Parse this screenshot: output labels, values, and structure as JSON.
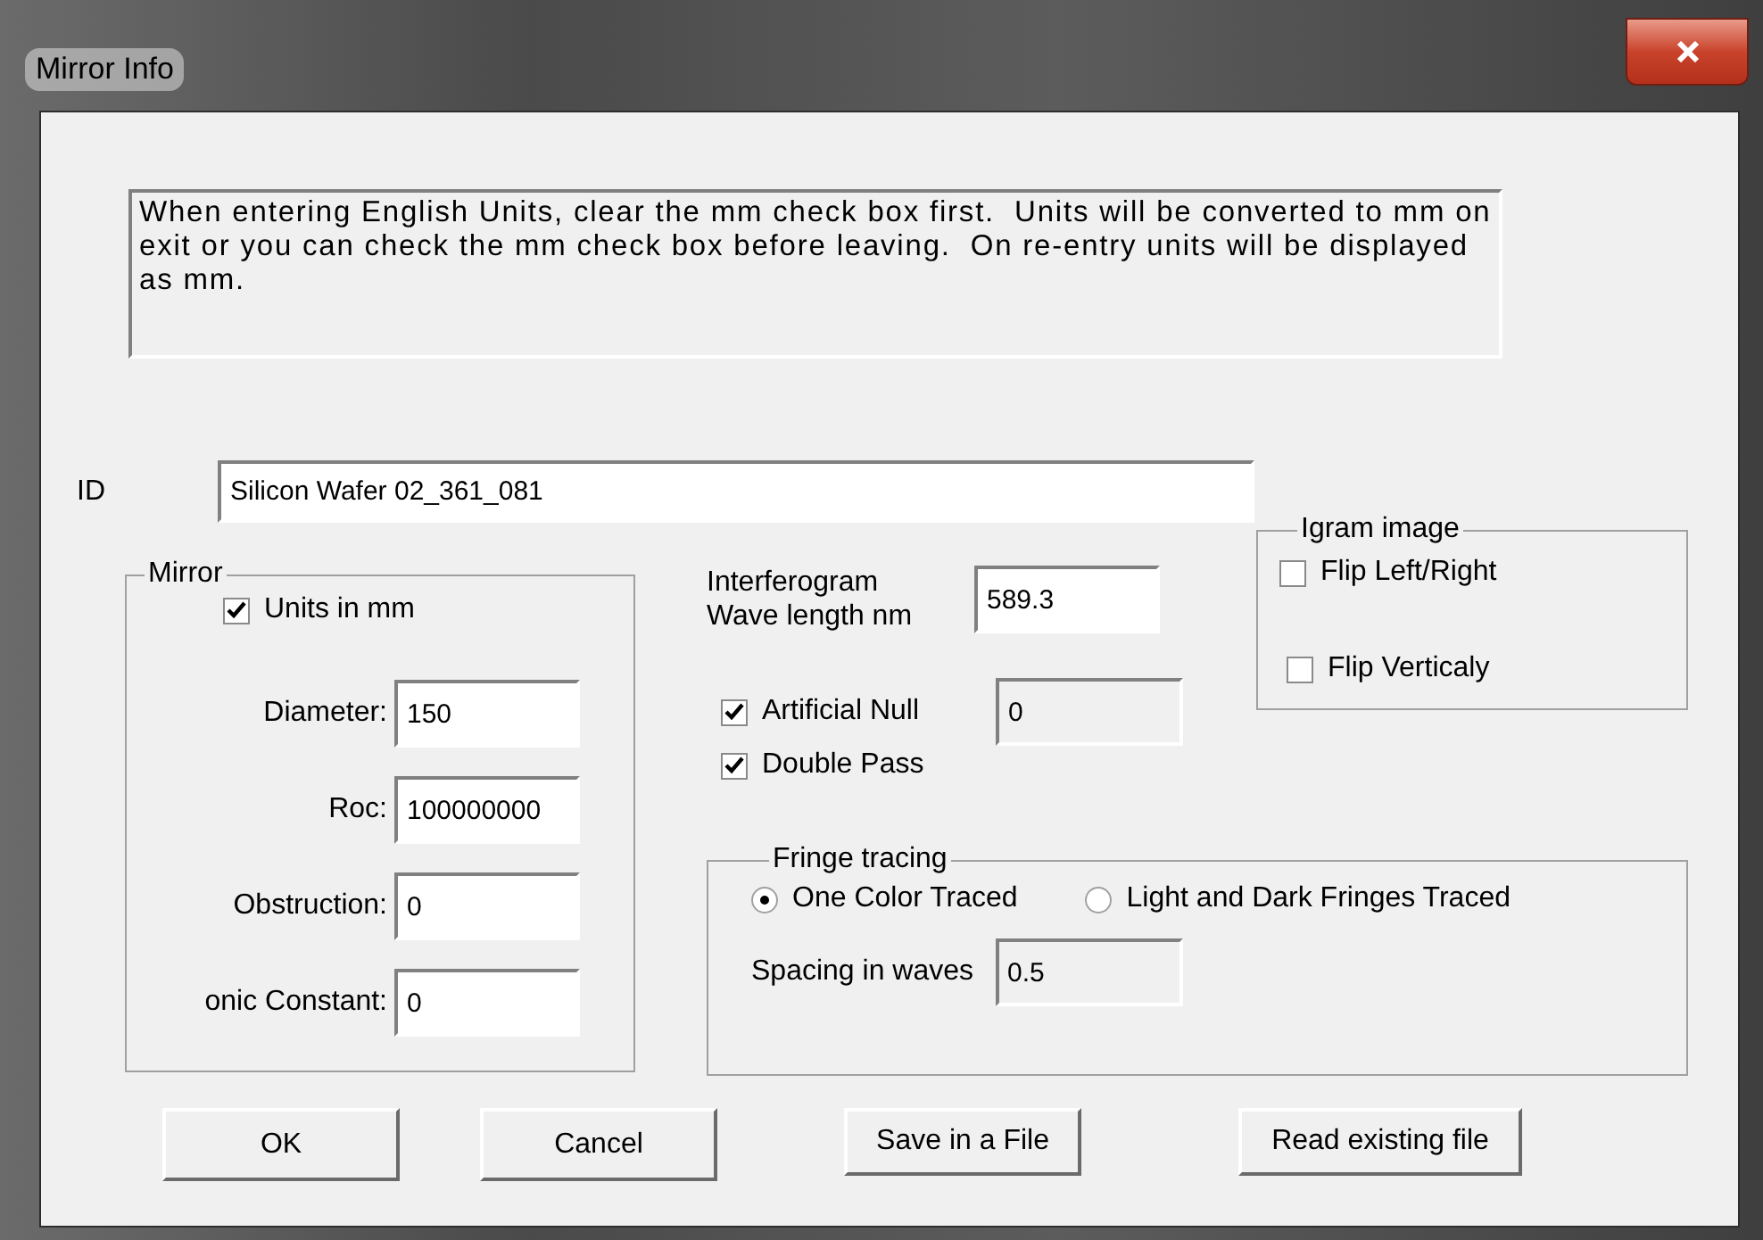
{
  "window": {
    "title": "Mirror Info"
  },
  "note": "When entering English Units, clear the mm check box first.  Units will be converted to mm on exit or you can check the mm check box before leaving.  On re-entry units will be displayed as mm.",
  "id": {
    "label": "ID",
    "value": "Silicon Wafer 02_361_081"
  },
  "mirror": {
    "title": "Mirror",
    "units": {
      "label": "Units in mm",
      "checked": true
    },
    "fields": [
      {
        "label": "Diameter:",
        "value": "150"
      },
      {
        "label": "Roc:",
        "value": "100000000"
      },
      {
        "label": "Obstruction:",
        "value": "0"
      },
      {
        "label": "onic Constant:",
        "value": "0"
      }
    ]
  },
  "wavelength": {
    "label": "Interferogram Wave length nm",
    "value": "589.3",
    "disabled": false
  },
  "artificial_null": {
    "label": "Artificial Null",
    "checked": true,
    "value": "0",
    "disabled": true
  },
  "double_pass": {
    "label": "Double Pass",
    "checked": true
  },
  "igram": {
    "title": "Igram image",
    "options": [
      {
        "label": "Flip Left/Right",
        "checked": false
      },
      {
        "label": "Flip Verticaly",
        "checked": false
      }
    ]
  },
  "fringe": {
    "title": "Fringe tracing",
    "options": [
      {
        "label": "One Color Traced",
        "selected": true
      },
      {
        "label": "Light and Dark Fringes Traced",
        "selected": false
      }
    ],
    "spacing": {
      "label": "Spacing in waves",
      "value": "0.5",
      "disabled": true
    }
  },
  "buttons": [
    "OK",
    "Cancel",
    "Save in a File",
    "Read existing file"
  ]
}
